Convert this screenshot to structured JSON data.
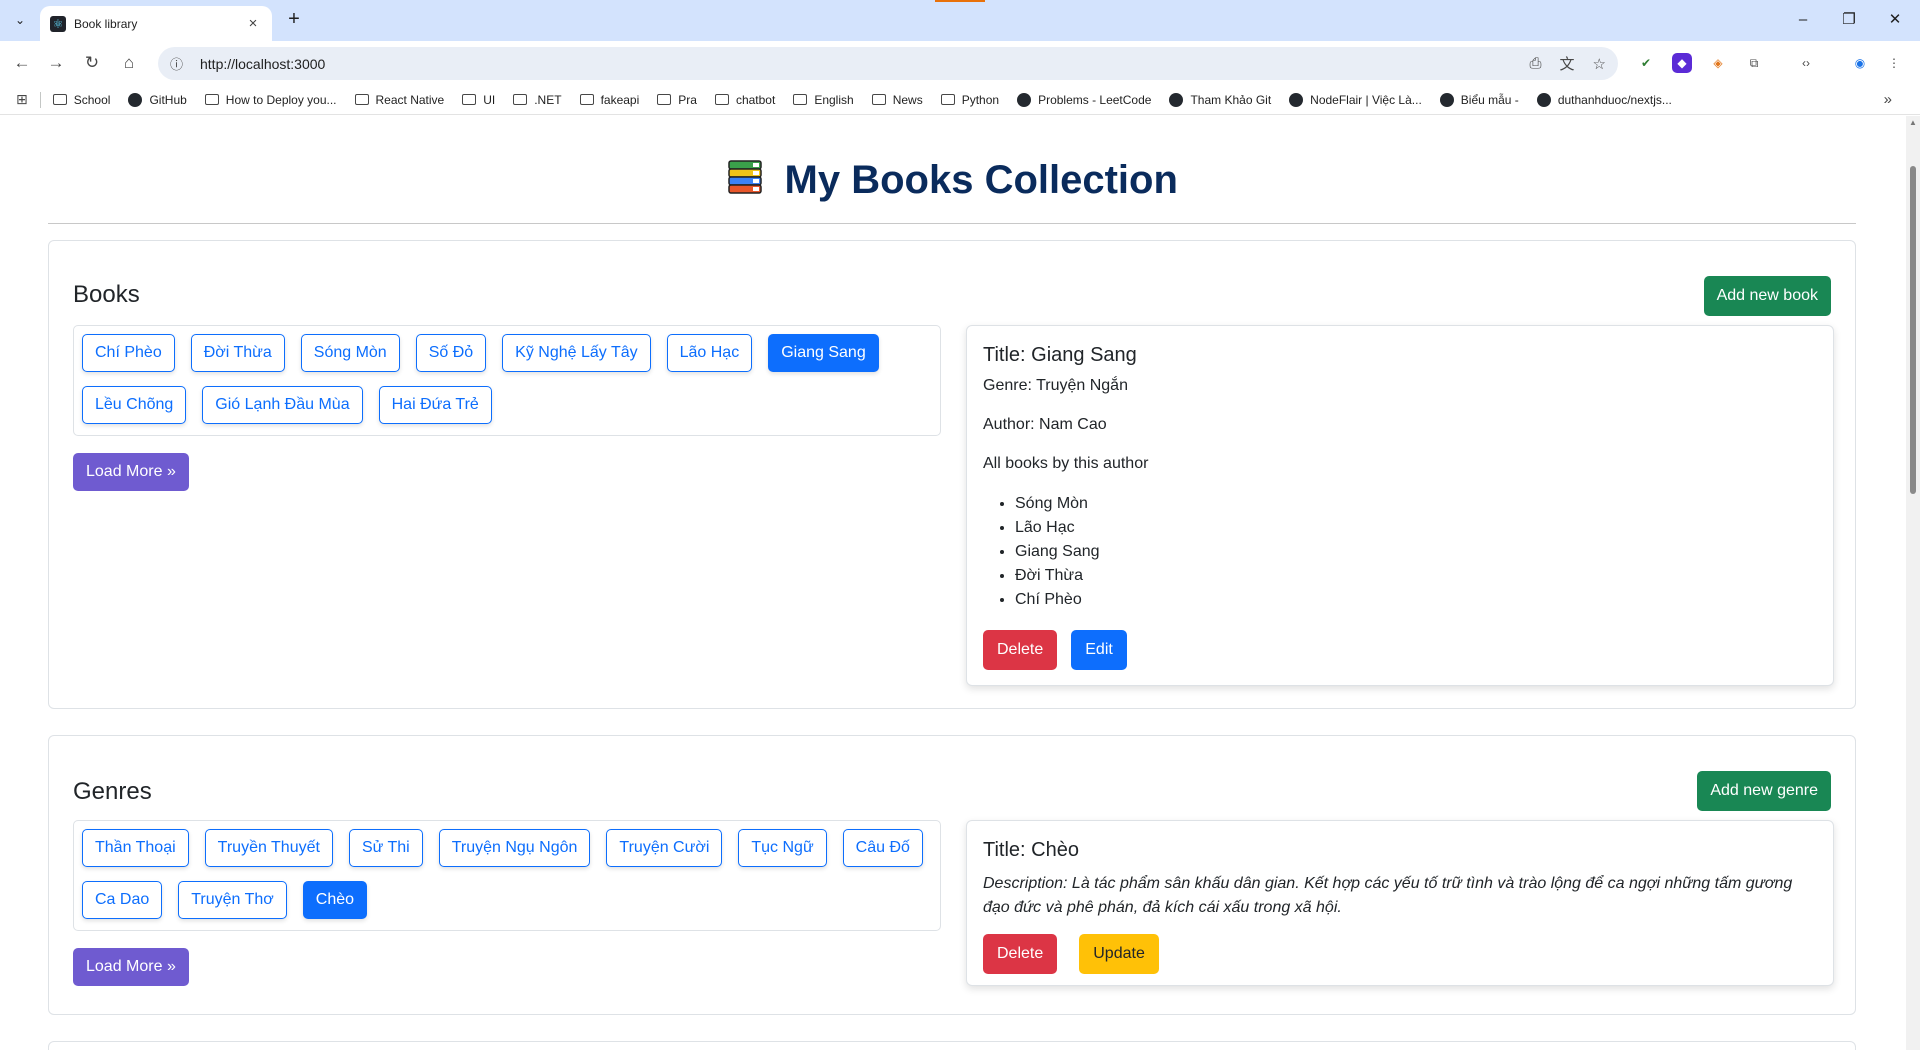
{
  "browser": {
    "tab_title": "Book library",
    "url": "http://localhost:3000",
    "bookmarks": [
      {
        "label": "School",
        "type": "folder"
      },
      {
        "label": "GitHub",
        "type": "site"
      },
      {
        "label": "How to Deploy you...",
        "type": "folder"
      },
      {
        "label": "React Native",
        "type": "folder"
      },
      {
        "label": "UI",
        "type": "folder"
      },
      {
        "label": ".NET",
        "type": "folder"
      },
      {
        "label": "fakeapi",
        "type": "folder"
      },
      {
        "label": "Pra",
        "type": "folder"
      },
      {
        "label": "chatbot",
        "type": "folder"
      },
      {
        "label": "English",
        "type": "folder"
      },
      {
        "label": "News",
        "type": "folder"
      },
      {
        "label": "Python",
        "type": "folder"
      },
      {
        "label": "Problems - LeetCode",
        "type": "site"
      },
      {
        "label": "Tham Khảo Git",
        "type": "site"
      },
      {
        "label": "NodeFlair | Việc Là...",
        "type": "site"
      },
      {
        "label": "Biểu mẫu -",
        "type": "site"
      },
      {
        "label": "duthanhduoc/nextjs...",
        "type": "site"
      }
    ]
  },
  "page": {
    "title": "My Books Collection",
    "title_icon": "books-emoji"
  },
  "books_section": {
    "title": "Books",
    "add_label": "Add new book",
    "load_more_label": "Load More »",
    "rows": [
      [
        {
          "label": "Chí Phèo",
          "active": false
        },
        {
          "label": "Đời Thừa",
          "active": false
        },
        {
          "label": "Sóng Mòn",
          "active": false
        },
        {
          "label": "Số Đỏ",
          "active": false
        },
        {
          "label": "Kỹ Nghệ Lấy Tây",
          "active": false
        },
        {
          "label": "Lão Hạc",
          "active": false
        },
        {
          "label": "Giang Sang",
          "active": true
        }
      ],
      [
        {
          "label": "Lều Chõng",
          "active": false
        },
        {
          "label": "Gió Lạnh Đầu Mùa",
          "active": false
        },
        {
          "label": "Hai Đứa Trẻ",
          "active": false
        }
      ]
    ],
    "detail": {
      "title": "Title: Giang Sang",
      "genre": "Genre: Truyện Ngắn",
      "author": "Author: Nam Cao",
      "all_books_label": "All books by this author",
      "author_books": [
        "Sóng Mòn",
        "Lão Hạc",
        "Giang Sang",
        "Đời Thừa",
        "Chí Phèo"
      ],
      "delete_label": "Delete",
      "edit_label": "Edit"
    }
  },
  "genres_section": {
    "title": "Genres",
    "add_label": "Add new genre",
    "load_more_label": "Load More »",
    "rows": [
      [
        {
          "label": "Thần Thoại",
          "active": false
        },
        {
          "label": "Truyền Thuyết",
          "active": false
        },
        {
          "label": "Sử Thi",
          "active": false
        },
        {
          "label": "Truyện Ngụ Ngôn",
          "active": false
        },
        {
          "label": "Truyện Cười",
          "active": false
        },
        {
          "label": "Tục Ngữ",
          "active": false
        },
        {
          "label": "Câu Đố",
          "active": false
        }
      ],
      [
        {
          "label": "Ca Dao",
          "active": false
        },
        {
          "label": "Truyện Thơ",
          "active": false
        },
        {
          "label": "Chèo",
          "active": true
        }
      ]
    ],
    "detail": {
      "title": "Title: Chèo",
      "description": "Description: Là tác phẩm sân khấu dân gian. Kết hợp các yếu tố trữ tình và trào lộng để ca ngợi những tấm gương đạo đức và phê phán, đả kích cái xấu trong xã hội.",
      "delete_label": "Delete",
      "update_label": "Update"
    }
  },
  "colors": {
    "primary": "#0d6efd",
    "success": "#198754",
    "danger": "#dc3545",
    "warning": "#ffc107",
    "purple": "#6f5bd0",
    "heading": "#0a2b5c"
  }
}
